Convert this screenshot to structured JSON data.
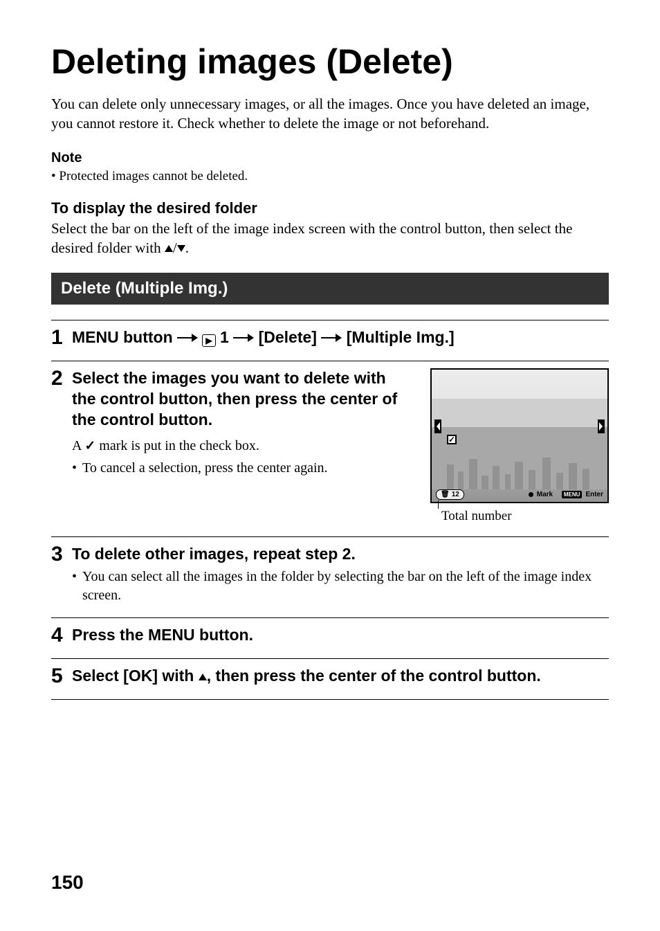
{
  "title": "Deleting images (Delete)",
  "intro": "You can delete only unnecessary images, or all the images. Once you have deleted an image, you cannot restore it. Check whether to delete the image or not beforehand.",
  "note": {
    "heading": "Note",
    "body": "Protected images cannot be deleted."
  },
  "folder": {
    "heading": "To display the desired folder",
    "body_a": "Select the bar on the left of the image index screen with the control button, then select the desired folder with ",
    "body_b": "."
  },
  "banner": "Delete (Multiple Img.)",
  "step1": {
    "num": "1",
    "lead": "MENU button ",
    "menu_num": " 1 ",
    "delete": " [Delete] ",
    "multi": " [Multiple Img.]"
  },
  "step2": {
    "num": "2",
    "head": "Select the images you want to delete with the control button, then press the center of the control button.",
    "sub_a": "A ",
    "sub_b": " mark is put in the check box.",
    "bullet": "To cancel a selection, press the center again.",
    "figure_label": "Total number",
    "camera": {
      "count": "12",
      "mark": "Mark",
      "menu": "MENU",
      "enter": "Enter"
    }
  },
  "step3": {
    "num": "3",
    "head": "To delete other images, repeat step 2.",
    "bullet": "You can select all the images in the folder by selecting the bar on the left of the image index screen."
  },
  "step4": {
    "num": "4",
    "head": "Press the MENU button."
  },
  "step5": {
    "num": "5",
    "head_a": "Select [OK] with ",
    "head_b": ", then press the center of the control button."
  },
  "page_number": "150"
}
